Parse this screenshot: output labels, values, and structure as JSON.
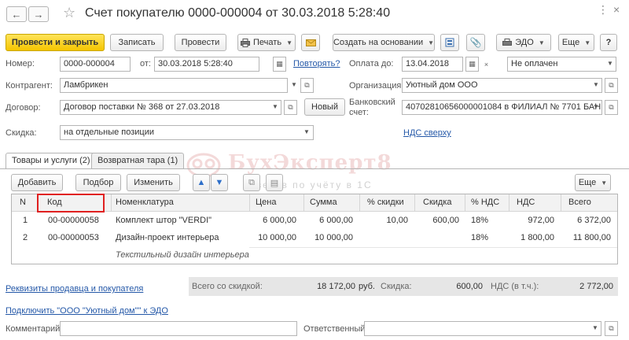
{
  "window": {
    "title": "Счет покупателю 0000-000004 от 30.03.2018 5:28:40",
    "controls": [
      "⋮",
      "×"
    ]
  },
  "nav": {
    "back": "←",
    "forward": "→"
  },
  "toolbar": {
    "post_close": "Провести и закрыть",
    "write": "Записать",
    "post": "Провести",
    "print": "Печать",
    "create_based": "Создать на основании",
    "edo": "ЭДО",
    "more": "Еще",
    "help": "?"
  },
  "form": {
    "number_label": "Номер:",
    "number_value": "0000-000004",
    "date_label": "от:",
    "date_value": "30.03.2018  5:28:40",
    "repeat_link": "Повторять?",
    "payment_due_label": "Оплата до:",
    "payment_due_value": "13.04.2018",
    "payment_status": "Не оплачен",
    "counterparty_label": "Контрагент:",
    "counterparty_value": "Ламбрикен",
    "organization_label": "Организация:",
    "organization_value": "Уютный дом ООО",
    "contract_label": "Договор:",
    "contract_value": "Договор поставки № 368 от 27.03.2018",
    "new_button": "Новый",
    "bank_label_1": "Банковский",
    "bank_label_2": "счет:",
    "bank_value": "40702810656000001084 в ФИЛИАЛ № 7701 БАНК",
    "discount_label": "Скидка:",
    "discount_value": "на отдельные позиции",
    "vat_link": "НДС сверху"
  },
  "tabs": [
    "Товары и услуги (2)",
    "Возвратная тара (1)"
  ],
  "table_toolbar": {
    "add": "Добавить",
    "select": "Подбор",
    "change": "Изменить",
    "more": "Еще"
  },
  "table": {
    "columns": [
      "N",
      "Код",
      "Номенклатура",
      "Цена",
      "Сумма",
      "% скидки",
      "Скидка",
      "% НДС",
      "НДС",
      "Всего"
    ],
    "rows": [
      [
        "1",
        "00-00000058",
        "Комплект штор \"VERDI\"",
        "6 000,00",
        "6 000,00",
        "10,00",
        "600,00",
        "18%",
        "972,00",
        "6 372,00"
      ],
      [
        "2",
        "00-00000053",
        "Дизайн-проект интерьера",
        "10 000,00",
        "10 000,00",
        "",
        "",
        "18%",
        "1 800,00",
        "11 800,00"
      ]
    ],
    "row2_sub": "Текстильный дизайн интерьера"
  },
  "totals": {
    "label_total": "Всего со скидкой:",
    "total_value": "18 172,00",
    "currency": "руб.",
    "label_discount": "Скидка:",
    "discount_value": "600,00",
    "label_vat": "НДС (в т.ч.):",
    "vat_value": "2 772,00"
  },
  "links": {
    "requisites": "Реквизиты продавца и покупателя",
    "connect_edo": "Подключить \"ООО \"Уютный дом\"\" к ЭДО"
  },
  "footer": {
    "comment_label": "Комментарий:",
    "responsible_label": "Ответственный:"
  },
  "watermark": {
    "brand": "БухЭксперт8",
    "tagline": "ответов по учёту в 1С"
  }
}
